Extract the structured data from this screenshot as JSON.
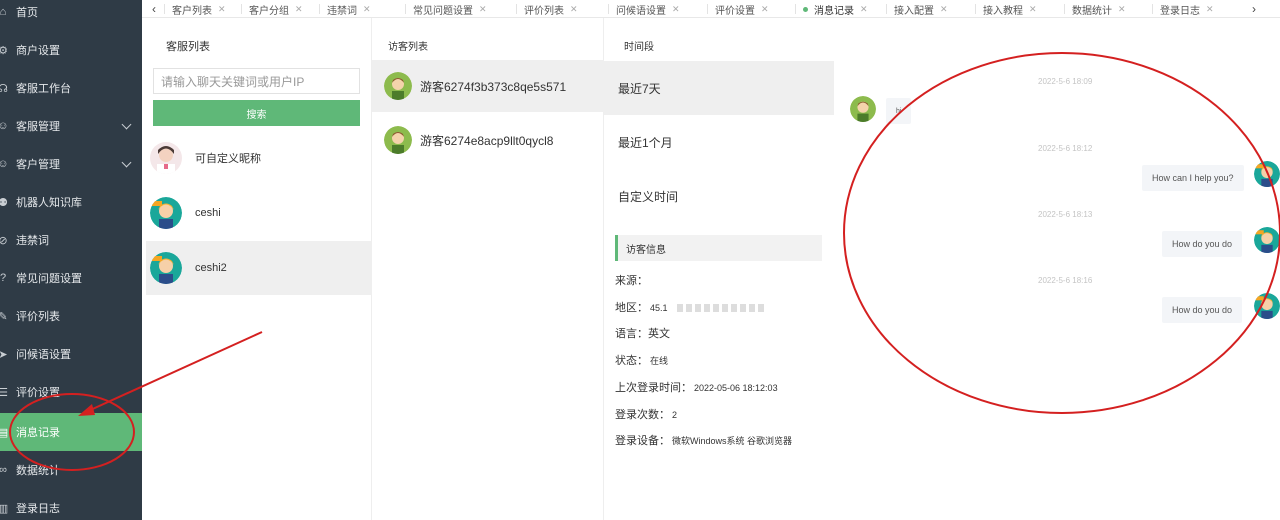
{
  "sidebar": {
    "items": [
      {
        "label": "首页",
        "icon": "home-icon",
        "glyph": "⌂",
        "expandable": false
      },
      {
        "label": "商户设置",
        "icon": "gear-icon",
        "glyph": "⚙",
        "expandable": false
      },
      {
        "label": "客服工作台",
        "icon": "headset-icon",
        "glyph": "☊",
        "expandable": false
      },
      {
        "label": "客服管理",
        "icon": "user-icon",
        "glyph": "☺",
        "expandable": true
      },
      {
        "label": "客户管理",
        "icon": "user-icon",
        "glyph": "☺",
        "expandable": true
      },
      {
        "label": "机器人知识库",
        "icon": "robot-icon",
        "glyph": "⚉",
        "expandable": false
      },
      {
        "label": "违禁词",
        "icon": "ban-icon",
        "glyph": "⊘",
        "expandable": false
      },
      {
        "label": "常见问题设置",
        "icon": "question-icon",
        "glyph": "?",
        "expandable": false
      },
      {
        "label": "评价列表",
        "icon": "edit-icon",
        "glyph": "✎",
        "expandable": false
      },
      {
        "label": "问候语设置",
        "icon": "send-icon",
        "glyph": "➤",
        "expandable": false
      },
      {
        "label": "评价设置",
        "icon": "list-icon",
        "glyph": "☰",
        "expandable": false
      },
      {
        "label": "消息记录",
        "icon": "message-icon",
        "glyph": "▤",
        "expandable": false,
        "active": true
      },
      {
        "label": "数据统计",
        "icon": "chart-icon",
        "glyph": "∞",
        "expandable": false
      },
      {
        "label": "登录日志",
        "icon": "log-icon",
        "glyph": "▥",
        "expandable": false
      }
    ]
  },
  "tabs": [
    {
      "label": "客户列表"
    },
    {
      "label": "客户分组"
    },
    {
      "label": "违禁词"
    },
    {
      "label": "常见问题设置"
    },
    {
      "label": "评价列表"
    },
    {
      "label": "问候语设置"
    },
    {
      "label": "评价设置"
    },
    {
      "label": "消息记录",
      "active": true
    },
    {
      "label": "接入配置"
    },
    {
      "label": "接入教程"
    },
    {
      "label": "数据统计"
    },
    {
      "label": "登录日志"
    }
  ],
  "cs_panel": {
    "title": "客服列表",
    "search_placeholder": "请输入聊天关键词或用户IP",
    "search_button": "搜索",
    "items": [
      {
        "name": "可自定义昵称"
      },
      {
        "name": "ceshi"
      },
      {
        "name": "ceshi2",
        "active": true
      }
    ]
  },
  "visitor_panel": {
    "title": "访客列表",
    "items": [
      {
        "name": "游客6274f3b373c8qe5s571",
        "active": true
      },
      {
        "name": "游客6274e8acp9llt0qycl8"
      }
    ]
  },
  "period_panel": {
    "title": "时间段",
    "items": [
      {
        "label": "最近7天",
        "active": true
      },
      {
        "label": "最近1个月"
      },
      {
        "label": "自定义时间"
      }
    ]
  },
  "visitor_info": {
    "title": "访客信息",
    "rows": [
      {
        "label": "来源：",
        "value": ""
      },
      {
        "label": "地区：",
        "value": "45.1"
      },
      {
        "label": "语言：",
        "value": "英文"
      },
      {
        "label": "状态：",
        "value": "在线"
      },
      {
        "label": "上次登录时间：",
        "value": "2022-05-06 18:12:03"
      },
      {
        "label": "登录次数：",
        "value": "2"
      },
      {
        "label": "登录设备：",
        "value": "微软Windows系统 谷歌浏览器"
      }
    ]
  },
  "chat": {
    "messages": [
      {
        "time": "2022-5-6 18:09",
        "side": "left",
        "text": "hi"
      },
      {
        "time": "2022-5-6 18:12",
        "side": "right",
        "text": "How can I help you?"
      },
      {
        "time": "2022-5-6 18:13",
        "side": "right",
        "text": "How do you do"
      },
      {
        "time": "2022-5-6 18:16",
        "side": "right",
        "text": "How do you do"
      }
    ]
  },
  "colors": {
    "accent": "#5fb878",
    "sidebar_bg": "#2f3b46",
    "annotation": "#d42020"
  }
}
